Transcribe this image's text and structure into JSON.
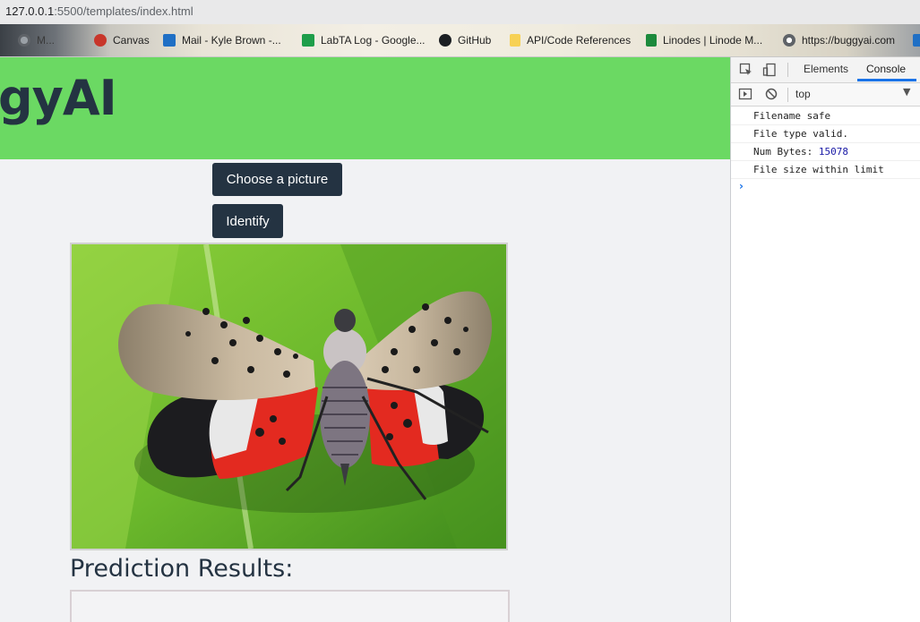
{
  "browser": {
    "url_host": "127.0.0.1",
    "url_rest": ":5500/templates/index.html"
  },
  "bookmarks": [
    {
      "label": "M...",
      "icon": "globe-icon"
    },
    {
      "label": "Canvas",
      "icon": "canvas-icon"
    },
    {
      "label": "Mail - Kyle Brown -...",
      "icon": "outlook-icon"
    },
    {
      "label": "LabTA Log - Google...",
      "icon": "sheets-icon"
    },
    {
      "label": "GitHub",
      "icon": "github-icon"
    },
    {
      "label": "API/Code References",
      "icon": "folder-icon"
    },
    {
      "label": "Linodes | Linode M...",
      "icon": "linode-icon"
    },
    {
      "label": "https://buggyai.com",
      "icon": "globe-icon"
    }
  ],
  "page": {
    "brand": "gyAI",
    "choose_label": "Choose a picture",
    "identify_label": "Identify",
    "results_title": "Prediction Results:"
  },
  "devtools": {
    "tabs": [
      "Elements",
      "Console"
    ],
    "active_tab": "Console",
    "context": "top",
    "logs": [
      {
        "text": "Filename safe"
      },
      {
        "text": "File type valid."
      },
      {
        "text": "Num Bytes: ",
        "value": "15078"
      },
      {
        "text": "File size within limit"
      }
    ],
    "prompt": "›"
  },
  "colors": {
    "header_bg": "#6bd963",
    "button_bg": "#243342",
    "brand_text": "#243342",
    "devtools_accent": "#1a73e8"
  }
}
